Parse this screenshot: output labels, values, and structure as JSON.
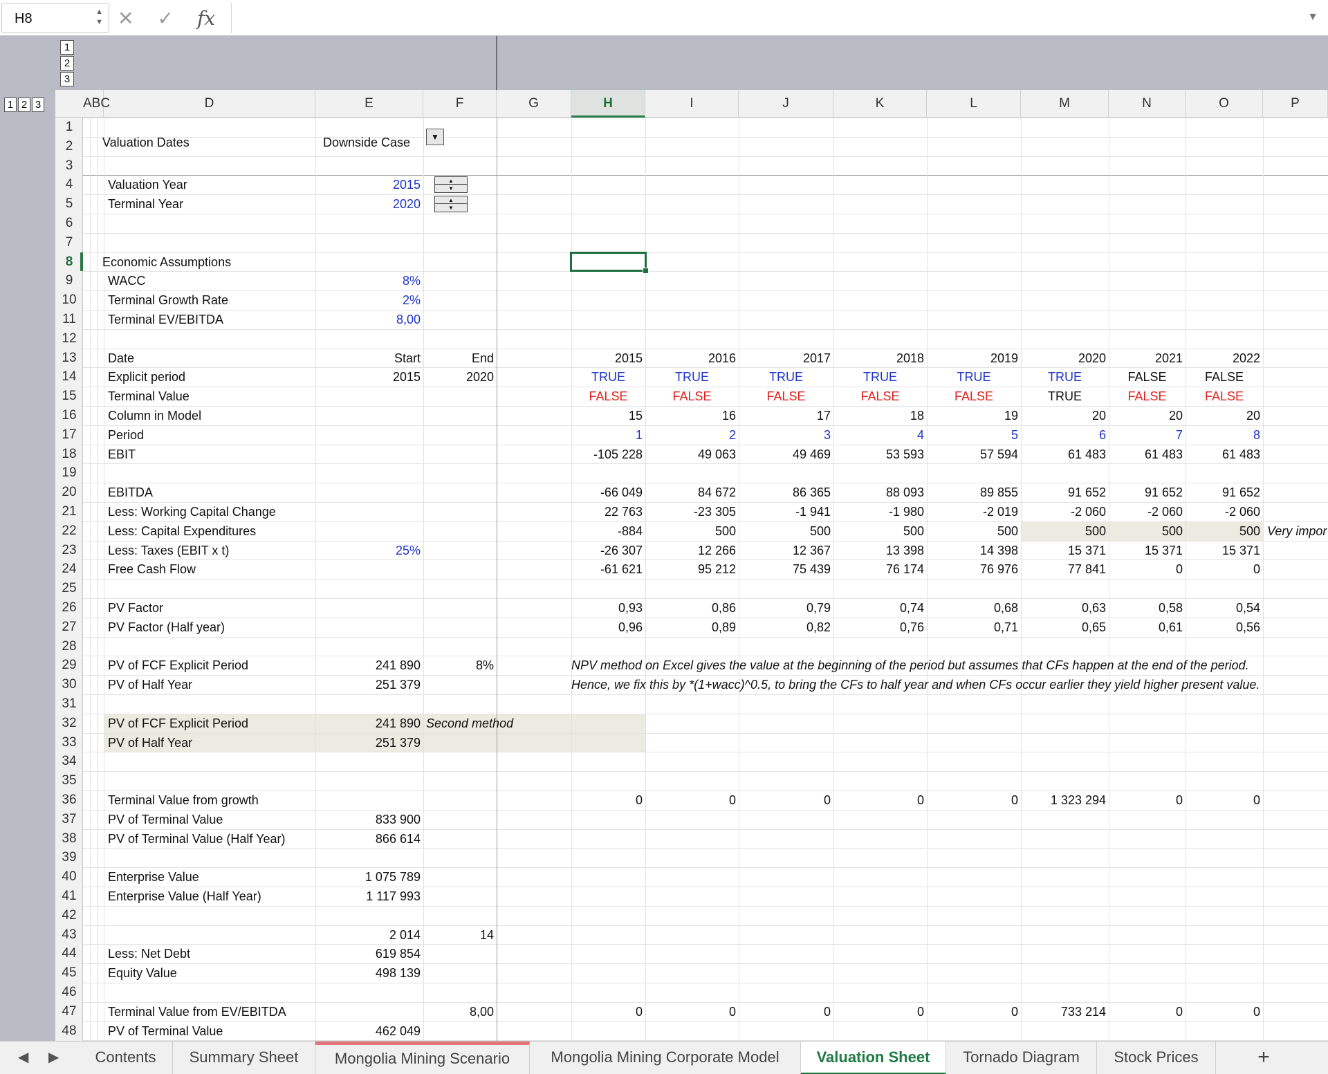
{
  "formula_bar": {
    "name_box": "H8",
    "cancel_icon": "✕",
    "enter_icon": "✓",
    "fx_label": "fx",
    "formula": ""
  },
  "outline": {
    "row_levels": [
      "1",
      "2",
      "3"
    ],
    "col_levels": [
      "1",
      "2",
      "3"
    ]
  },
  "columns": [
    "ABC",
    "D",
    "E",
    "F",
    "G",
    "H",
    "I",
    "J",
    "K",
    "L",
    "M",
    "N",
    "O",
    "P"
  ],
  "selected_column": "H",
  "selected_row": "8",
  "rows": [
    "1",
    "2",
    "3",
    "4",
    "5",
    "6",
    "7",
    "8",
    "9",
    "10",
    "11",
    "12",
    "13",
    "14",
    "15",
    "16",
    "17",
    "18",
    "19",
    "20",
    "21",
    "22",
    "23",
    "24",
    "25",
    "26",
    "27",
    "28",
    "29",
    "30",
    "31",
    "32",
    "33",
    "34",
    "35",
    "36",
    "37",
    "38",
    "39",
    "40",
    "41",
    "42",
    "43",
    "44",
    "45",
    "46",
    "47",
    "48"
  ],
  "sheet": {
    "r2": {
      "D": "Valuation Dates",
      "E": "Downside Case"
    },
    "r4": {
      "D": "Valuation Year",
      "E": "2015"
    },
    "r5": {
      "D": "Terminal Year",
      "E": "2020"
    },
    "r8": {
      "D": "Economic Assumptions"
    },
    "r9": {
      "D": "WACC",
      "E": "8%"
    },
    "r10": {
      "D": "Terminal Growth Rate",
      "E": "2%"
    },
    "r11": {
      "D": "Terminal EV/EBITDA",
      "E": "8,00"
    },
    "r13": {
      "D": "Date",
      "E": "Start",
      "F": "End",
      "H": "2015",
      "I": "2016",
      "J": "2017",
      "K": "2018",
      "L": "2019",
      "M": "2020",
      "N": "2021",
      "O": "2022"
    },
    "r14": {
      "D": "Explicit period",
      "E": "2015",
      "F": "2020",
      "H": "TRUE",
      "I": "TRUE",
      "J": "TRUE",
      "K": "TRUE",
      "L": "TRUE",
      "M": "TRUE",
      "N": "FALSE",
      "O": "FALSE"
    },
    "r15": {
      "D": "Terminal Value",
      "H": "FALSE",
      "I": "FALSE",
      "J": "FALSE",
      "K": "FALSE",
      "L": "FALSE",
      "M": "TRUE",
      "N": "FALSE",
      "O": "FALSE"
    },
    "r16": {
      "D": "Column in Model",
      "H": "15",
      "I": "16",
      "J": "17",
      "K": "18",
      "L": "19",
      "M": "20",
      "N": "20",
      "O": "20"
    },
    "r17": {
      "D": "Period",
      "H": "1",
      "I": "2",
      "J": "3",
      "K": "4",
      "L": "5",
      "M": "6",
      "N": "7",
      "O": "8"
    },
    "r18": {
      "D": "EBIT",
      "H": "-105 228",
      "I": "49 063",
      "J": "49 469",
      "K": "53 593",
      "L": "57 594",
      "M": "61 483",
      "N": "61 483",
      "O": "61 483"
    },
    "r20": {
      "D": "EBITDA",
      "H": "-66 049",
      "I": "84 672",
      "J": "86 365",
      "K": "88 093",
      "L": "89 855",
      "M": "91 652",
      "N": "91 652",
      "O": "91 652"
    },
    "r21": {
      "D": "Less: Working Capital Change",
      "H": "22 763",
      "I": "-23 305",
      "J": "-1 941",
      "K": "-1 980",
      "L": "-2 019",
      "M": "-2 060",
      "N": "-2 060",
      "O": "-2 060"
    },
    "r22": {
      "D": "Less: Capital Expenditures",
      "H": "-884",
      "I": "500",
      "J": "500",
      "K": "500",
      "L": "500",
      "M": "500",
      "N": "500",
      "O": "500",
      "P": "Very impor"
    },
    "r23": {
      "D": "Less: Taxes (EBIT x t)",
      "E": "25%",
      "H": "-26 307",
      "I": "12 266",
      "J": "12 367",
      "K": "13 398",
      "L": "14 398",
      "M": "15 371",
      "N": "15 371",
      "O": "15 371"
    },
    "r24": {
      "D": "Free Cash Flow",
      "H": "-61 621",
      "I": "95 212",
      "J": "75 439",
      "K": "76 174",
      "L": "76 976",
      "M": "77 841",
      "N": "0",
      "O": "0"
    },
    "r26": {
      "D": "PV Factor",
      "H": "0,93",
      "I": "0,86",
      "J": "0,79",
      "K": "0,74",
      "L": "0,68",
      "M": "0,63",
      "N": "0,58",
      "O": "0,54"
    },
    "r27": {
      "D": "PV Factor (Half year)",
      "H": "0,96",
      "I": "0,89",
      "J": "0,82",
      "K": "0,76",
      "L": "0,71",
      "M": "0,65",
      "N": "0,61",
      "O": "0,56"
    },
    "r29": {
      "D": "PV of FCF Explicit Period",
      "E": "241 890",
      "F": "8%",
      "H": "NPV method on Excel gives the value at the beginning of the period but assumes that CFs happen at the end of the period."
    },
    "r30": {
      "D": "PV of Half Year",
      "E": "251 379",
      "H": "Hence, we fix this by *(1+wacc)^0.5, to bring the CFs to half year and when CFs occur earlier they yield higher present value."
    },
    "r32": {
      "D": "PV of FCF Explicit Period",
      "E": "241 890",
      "F": "Second method"
    },
    "r33": {
      "D": "PV of Half Year",
      "E": "251 379"
    },
    "r36": {
      "D": "Terminal Value from growth",
      "H": "0",
      "I": "0",
      "J": "0",
      "K": "0",
      "L": "0",
      "M": "1 323 294",
      "N": "0",
      "O": "0"
    },
    "r37": {
      "D": "PV of Terminal Value",
      "E": "833 900"
    },
    "r38": {
      "D": "PV of Terminal Value (Half Year)",
      "E": "866 614"
    },
    "r40": {
      "D": "Enterprise Value",
      "E": "1 075 789"
    },
    "r41": {
      "D": "Enterprise Value (Half Year)",
      "E": "1 117 993"
    },
    "r43": {
      "E": "2 014",
      "F": "14"
    },
    "r44": {
      "D": "Less: Net Debt",
      "E": "619 854"
    },
    "r45": {
      "D": "Equity Value",
      "E": "498 139"
    },
    "r47": {
      "D": "Terminal Value from EV/EBITDA",
      "F": "8,00",
      "H": "0",
      "I": "0",
      "J": "0",
      "K": "0",
      "L": "0",
      "M": "733 214",
      "N": "0",
      "O": "0"
    },
    "r48": {
      "D": "PV of Terminal Value",
      "E": "462 049"
    }
  },
  "tabs": {
    "nav_prev": "◀",
    "nav_next": "▶",
    "items": [
      "Contents",
      "Summary Sheet",
      "Mongolia Mining Scenario",
      "Mongolia Mining Corporate Model",
      "Valuation Sheet",
      "Tornado Diagram",
      "Stock Prices"
    ],
    "active": "Valuation Sheet",
    "add": "+"
  },
  "colors": {
    "selection": "#1e6f3d",
    "input_blue": "#1f35c8",
    "false_red": "#e0201c",
    "shade": "#ecebe1",
    "marked_tab": "#e6737a"
  }
}
